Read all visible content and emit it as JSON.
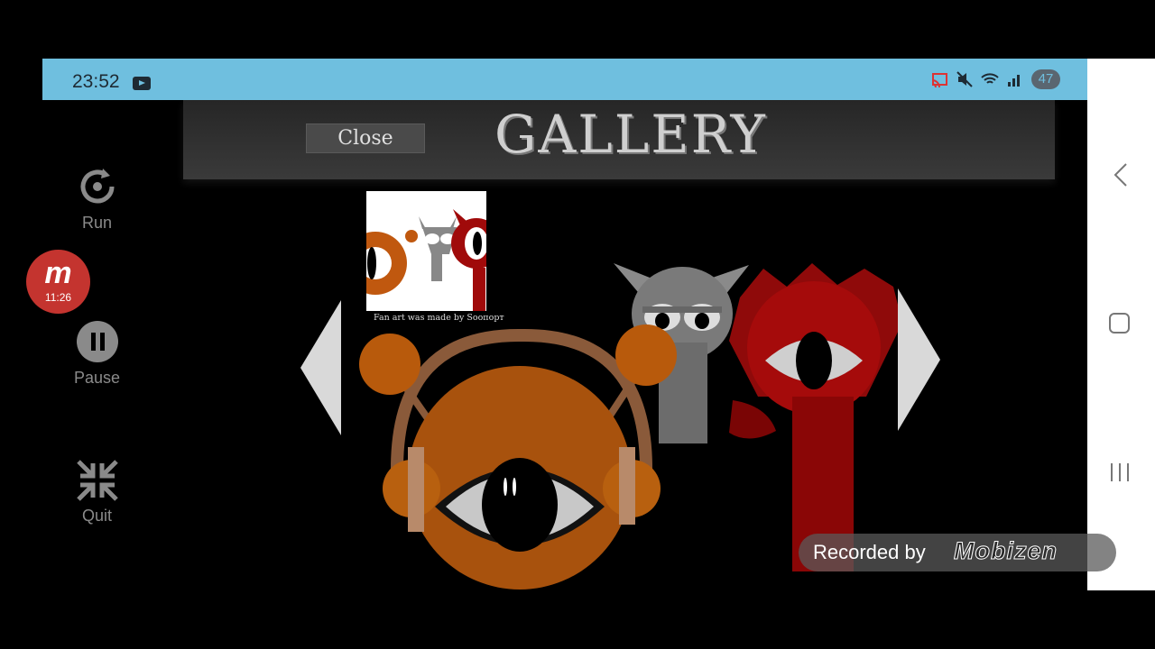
{
  "status_bar": {
    "time": "23:52",
    "battery": "47",
    "icons": [
      "youtube-icon",
      "cast-icon",
      "mute-icon",
      "wifi-icon",
      "signal-icon",
      "battery-icon"
    ]
  },
  "recorder_panel": {
    "run_label": "Run",
    "pause_label": "Pause",
    "quit_label": "Quit",
    "badge_letter": "m",
    "badge_time": "11:26"
  },
  "game": {
    "close_label": "Close",
    "title": "GALLERY",
    "thumbnail_caption": "Fan art was made by Sooпорт",
    "colors": {
      "header": "#2f2f2f",
      "arrow": "#d9d9d9",
      "orange": "#c0580f",
      "red": "#a00a0a",
      "gray": "#7a7a7a"
    }
  },
  "watermark": {
    "text": "Recorded by",
    "brand": "Mobizen"
  },
  "nav_bar": {
    "icons": [
      "back-icon",
      "home-icon",
      "recent-apps-icon"
    ]
  }
}
